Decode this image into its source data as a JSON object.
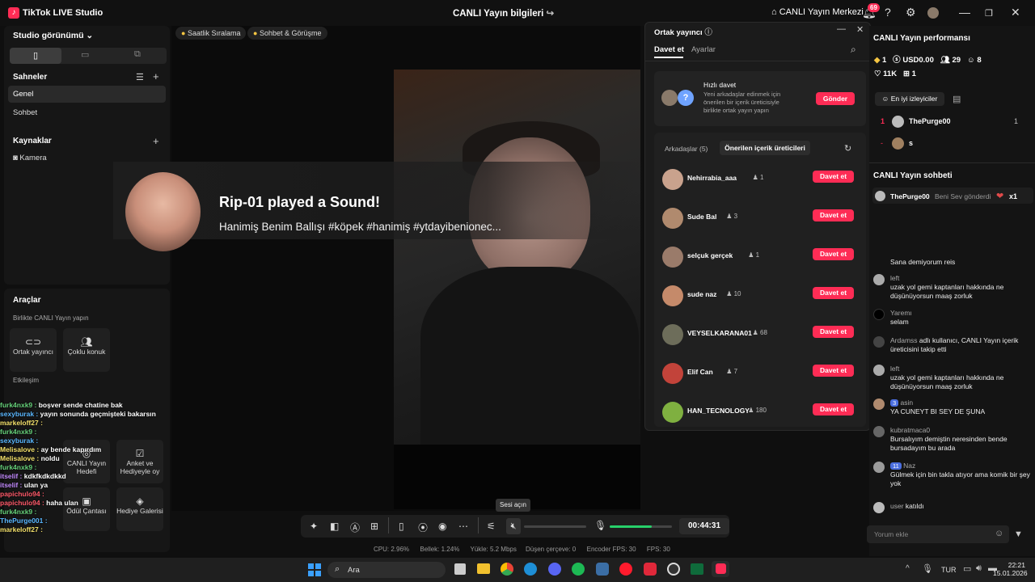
{
  "titlebar": {
    "app_name": "TikTok LIVE Studio",
    "center_title": "CANLI Yayın bilgileri",
    "live_center": "CANLI Yayın Merkezi",
    "notif_count": "69"
  },
  "left": {
    "studio_view": "Studio görünümü",
    "scenes_title": "Sahneler",
    "scenes": [
      "Genel",
      "Sohbet"
    ],
    "sources_title": "Kaynaklar",
    "source_camera": "Kamera",
    "tools_title": "Araçlar",
    "collab_title": "Birlikte CANLI Yayın yapın",
    "collab_tools": [
      "Ortak yayıncı",
      "Çoklu konuk"
    ],
    "interaction_title": "Etkileşim",
    "interaction_tools": [
      "CANLI Yayın Hedefi",
      "Anket ve Hediyeyle oy",
      "Ödül Çantası",
      "Hediye Galerisi"
    ]
  },
  "stage": {
    "chips": [
      "Saatlik Sıralama",
      "Sohbet & Görüşme"
    ],
    "notification_title": "Rip-01 played a Sound!",
    "notification_sub": "Hanimiş Benim Ballışı #köpek #hanimiş #ytdayibenionec..."
  },
  "overlay_chat": [
    {
      "user": "furk4nxk9 :",
      "text": "boşver sende chatine bak"
    },
    {
      "user": "sexyburak :",
      "text": "yayın sonunda geçmişteki bakarsın"
    },
    {
      "user": "markeloff27 :",
      "text": ""
    },
    {
      "user": "furk4nxk9 :",
      "text": ""
    },
    {
      "user": "sexyburak :",
      "text": ""
    },
    {
      "user": "Melisalove :",
      "text": "ay bende kapırdım"
    },
    {
      "user": "Melisalove :",
      "text": "noldu"
    },
    {
      "user": "furk4nxk9 :",
      "text": ""
    },
    {
      "user": "itselif :",
      "text": "kdkfkdkdkkd"
    },
    {
      "user": "itselif :",
      "text": "ulan ya"
    },
    {
      "user": "papichulo94 :",
      "text": ""
    },
    {
      "user": "papichulo94 :",
      "text": "haha ulan"
    },
    {
      "user": "furk4nxk9 :",
      "text": ""
    },
    {
      "user": "ThePurge001 :",
      "text": ""
    },
    {
      "user": "markeloff27 :",
      "text": ""
    }
  ],
  "cohost_panel": {
    "title": "Ortak yayıncı",
    "tabs": [
      "Davet et",
      "Ayarlar"
    ],
    "quick_title": "Hızlı davet",
    "quick_desc": "Yeni arkadaşlar edinmek için önerilen bir içerik üreticisiyle birlikte ortak yayın yapın",
    "send": "Gönder",
    "friends_tab": "Arkadaşlar (5)",
    "suggested_tab": "Önerilen içerik üreticileri",
    "invite_label": "Davet et",
    "creators": [
      {
        "name": "Nehirrabia_aaa",
        "count": "1",
        "color": "#c9a28d"
      },
      {
        "name": "Sude Bal",
        "count": "3",
        "color": "#b08a6e"
      },
      {
        "name": "selçuk gerçek",
        "count": "1",
        "color": "#9a7b6a"
      },
      {
        "name": "sude naz",
        "count": "10",
        "color": "#c58a6a"
      },
      {
        "name": "VEYSELKARANA01",
        "count": "68",
        "color": "#6d6d5a"
      },
      {
        "name": "Elif Can",
        "count": "7",
        "color": "#c2433a"
      },
      {
        "name": "HAN_TECNOLOGY",
        "count": "180",
        "color": "#7fb040"
      }
    ]
  },
  "right": {
    "perf_title": "CANLI Yayın performansı",
    "stat_diamond": "1",
    "stat_usd": "USD0.00",
    "stat_viewers": "29",
    "stat_followers": "8",
    "stat_likes": "11K",
    "stat_gifts": "1",
    "top_viewers_tab": "En iyi izleyiciler",
    "top_viewers": [
      {
        "rank": "1",
        "name": "ThePurge00",
        "score": "1"
      },
      {
        "rank": "-",
        "name": "s",
        "score": ""
      }
    ],
    "chat_title": "CANLI Yayın sohbeti",
    "pinned_user": "ThePurge00",
    "pinned_text": "Beni Sev gönderdi",
    "pinned_count": "x1",
    "messages": [
      {
        "user": "",
        "text": "Sana demiyorum reis"
      },
      {
        "user": "left",
        "text": "uzak yol gemi kaptanları hakkında ne düşünüyorsun maaş zorluk"
      },
      {
        "user": "Yaremı",
        "text": "selam"
      },
      {
        "user": "Ardamss",
        "text": "adlı kullanıcı, CANLI Yayın içerik üreticisini takip etti"
      },
      {
        "user": "left",
        "text": "uzak yol gemi kaptanları hakkında ne düşünüyorsun maaş zorluk"
      },
      {
        "user": "asin",
        "badge": "3",
        "text": "YA CUNEYT BI SEY DE ŞUNA"
      },
      {
        "user": "kubratmaca0",
        "text": "Bursalıyım demiştin neresinden bende bursadayım bu arada"
      },
      {
        "user": "Naz",
        "badge": "11",
        "text": "Gülmek için bin takla atıyor ama komik bir şey yok"
      },
      {
        "user": "user",
        "text": "katıldı"
      }
    ],
    "comment_placeholder": "Yorum ekle"
  },
  "controls": {
    "tooltip": "Sesi açın",
    "timer": "00:44:31",
    "volume_fraction": 0.68
  },
  "stats": {
    "cpu": "CPU: 2.96%",
    "memory": "Bellek: 1.24%",
    "upload": "Yükle: 5.2 Mbps",
    "dropped": "Düşen çerçeve: 0",
    "encoder_fps": "Encoder FPS: 30",
    "fps": "FPS: 30"
  },
  "taskbar": {
    "search": "Ara",
    "lang": "TUR",
    "time": "22:21",
    "date": "15.01.2026"
  }
}
